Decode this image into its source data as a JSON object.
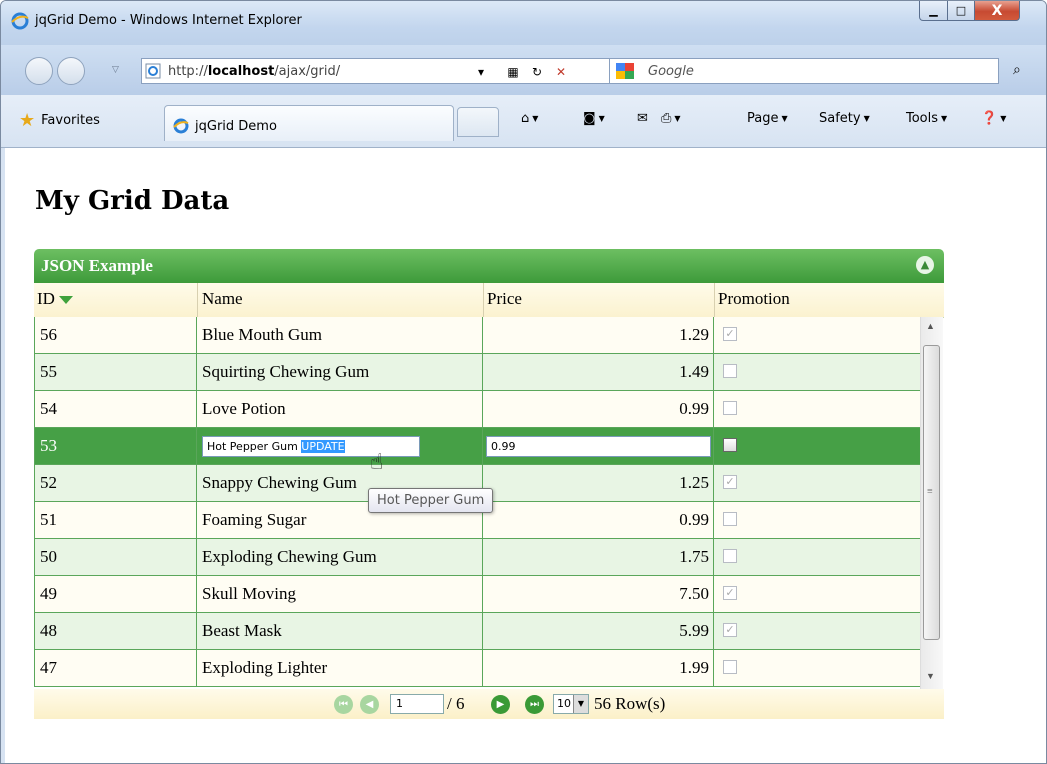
{
  "window": {
    "title": "jqGrid Demo - Windows Internet Explorer",
    "close_glyph": "X"
  },
  "address": {
    "url_prefix": "http://",
    "url_host": "localhost",
    "url_path": "/ajax/grid/"
  },
  "search": {
    "placeholder": "Google",
    "provider": "Google"
  },
  "favorites": {
    "label": "Favorites"
  },
  "tab": {
    "title": "jqGrid Demo"
  },
  "commands": {
    "page": "Page",
    "safety": "Safety",
    "tools": "Tools"
  },
  "page": {
    "title": "My Grid Data"
  },
  "grid": {
    "caption": "JSON Example",
    "columns": [
      "ID",
      "Name",
      "Price",
      "Promotion"
    ],
    "sort_column": "ID",
    "sort_direction": "desc",
    "rows": [
      {
        "id": "56",
        "name": "Blue Mouth Gum",
        "price": "1.29",
        "promotion": true
      },
      {
        "id": "55",
        "name": "Squirting Chewing Gum",
        "price": "1.49",
        "promotion": false
      },
      {
        "id": "54",
        "name": "Love Potion",
        "price": "0.99",
        "promotion": false
      },
      {
        "id": "53",
        "name": "Hot Pepper Gum",
        "name_edit_suffix": "UPDATE",
        "price": "0.99",
        "promotion": false,
        "editing": true
      },
      {
        "id": "52",
        "name": "Snappy Chewing Gum",
        "price": "1.25",
        "promotion": true
      },
      {
        "id": "51",
        "name": "Foaming Sugar",
        "price": "0.99",
        "promotion": false
      },
      {
        "id": "50",
        "name": "Exploding Chewing Gum",
        "price": "1.75",
        "promotion": false
      },
      {
        "id": "49",
        "name": "Skull Moving",
        "price": "7.50",
        "promotion": true
      },
      {
        "id": "48",
        "name": "Beast Mask",
        "price": "5.99",
        "promotion": true
      },
      {
        "id": "47",
        "name": "Exploding Lighter",
        "price": "1.99",
        "promotion": false
      }
    ],
    "pager": {
      "page": "1",
      "of": "/ 6",
      "rows_per_page": "10",
      "row_count": "56 Row(s)"
    }
  },
  "tooltip": {
    "text": "Hot Pepper Gum"
  },
  "colors": {
    "grid_green": "#46a046",
    "caption_green": "#3d9a3a",
    "highlight_blue": "#3399ff"
  }
}
